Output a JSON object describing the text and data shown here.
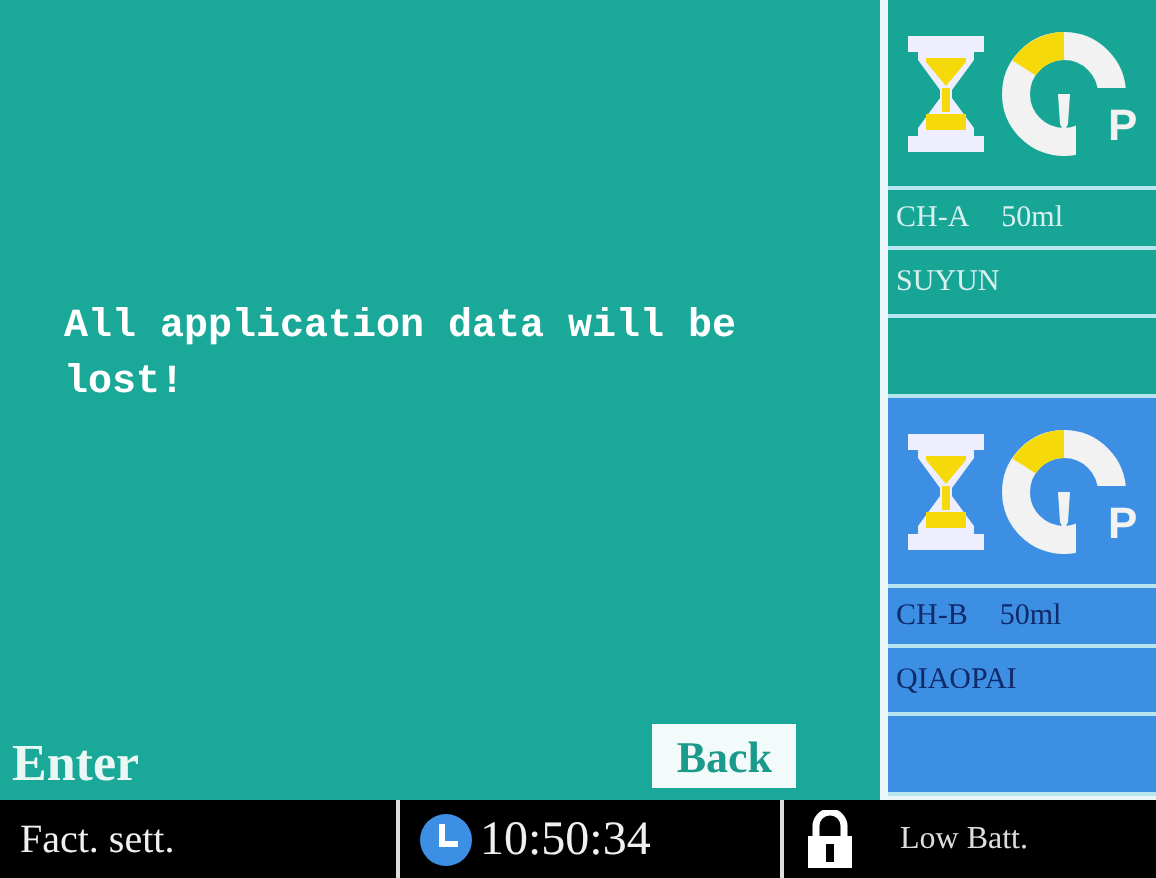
{
  "message": "All application data will be lost!",
  "softkeys": [
    {
      "label": "Enter",
      "selected": false
    },
    {
      "label": "Back",
      "selected": true
    }
  ],
  "channels": [
    {
      "label": "CH-A",
      "volume": "50ml",
      "name": "SUYUN",
      "pump_mode": "P",
      "color": "#17a595"
    },
    {
      "label": "CH-B",
      "volume": "50ml",
      "name": "QIAOPAI",
      "pump_mode": "P",
      "color": "#3d8fe3"
    }
  ],
  "status_bar": {
    "mode": "Fact. sett.",
    "time": "10:50:34",
    "locked": true,
    "battery": "Low Batt."
  }
}
